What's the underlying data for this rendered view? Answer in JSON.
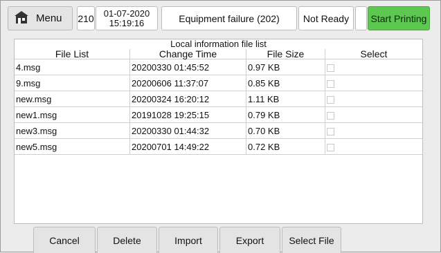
{
  "topbar": {
    "menu_label": "Menu",
    "count": "210",
    "date": "01-07-2020",
    "time": "15:19:16",
    "fault": "Equipment failure (202)",
    "status": "Not Ready",
    "start_label": "Start Printing",
    "start_color": "#5cc84f"
  },
  "panel": {
    "title": "Local information file list",
    "columns": [
      "File List",
      "Change Time",
      "File Size",
      "Select"
    ],
    "rows": [
      {
        "name": "4.msg",
        "time": "20200330 01:45:52",
        "size": "0.97 KB"
      },
      {
        "name": "9.msg",
        "time": "20200606 11:37:07",
        "size": "0.85 KB"
      },
      {
        "name": "new.msg",
        "time": "20200324 16:20:12",
        "size": "1.11 KB"
      },
      {
        "name": "new1.msg",
        "time": "20191028 19:25:15",
        "size": "0.79 KB"
      },
      {
        "name": "new3.msg",
        "time": "20200330 01:44:32",
        "size": "0.70 KB"
      },
      {
        "name": "new5.msg",
        "time": "20200701 14:49:22",
        "size": "0.72 KB"
      }
    ]
  },
  "buttons": {
    "cancel": "Cancel",
    "delete": "Delete",
    "import": "Import",
    "export": "Export",
    "select_file": "Select File"
  }
}
